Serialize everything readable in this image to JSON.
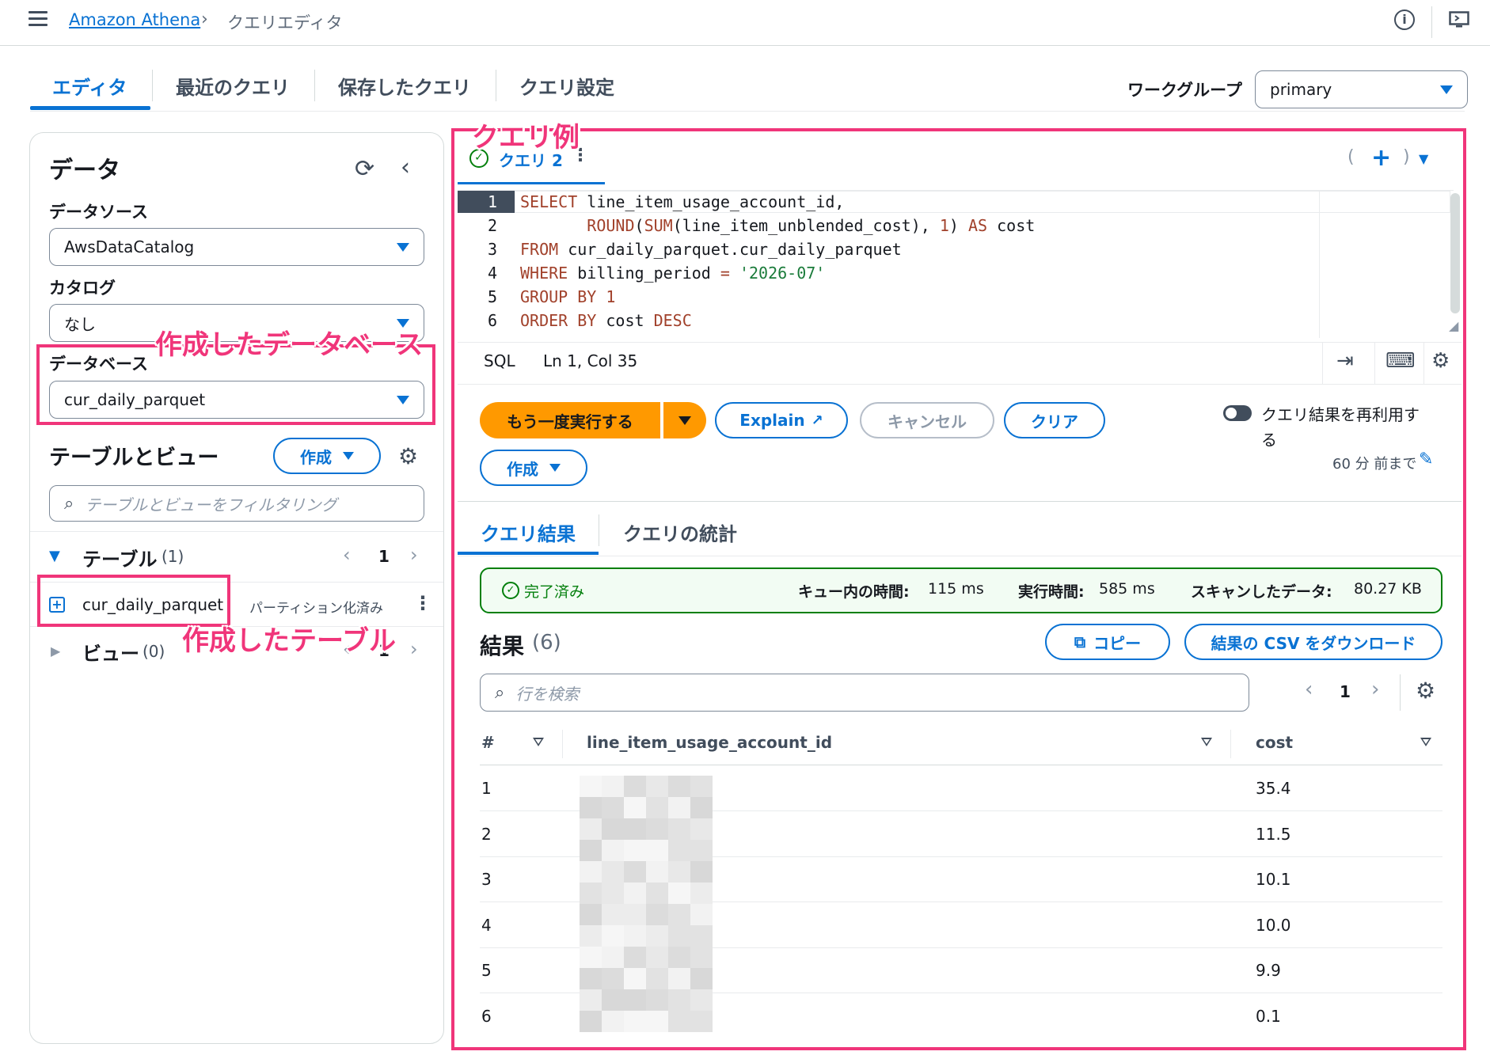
{
  "header": {
    "service_link": "Amazon Athena",
    "breadcrumb_sep": "›",
    "current_page": "クエリエディタ",
    "info_icon": "info-icon",
    "screen_icon": "screen-icon"
  },
  "tabs": [
    {
      "label": "エディタ",
      "active": true
    },
    {
      "label": "最近のクエリ",
      "active": false
    },
    {
      "label": "保存したクエリ",
      "active": false
    },
    {
      "label": "クエリ設定",
      "active": false
    }
  ],
  "workgroup": {
    "label": "ワークグループ",
    "value": "primary"
  },
  "data_panel": {
    "title": "データ",
    "datasource_label": "データソース",
    "datasource_value": "AwsDataCatalog",
    "catalog_label": "カタログ",
    "catalog_value": "なし",
    "database_label": "データベース",
    "database_value": "cur_daily_parquet",
    "tables_views_title": "テーブルとビュー",
    "create_button": "作成",
    "filter_placeholder": "テーブルとビューをフィルタリング",
    "tables_label": "テーブル",
    "tables_count": "(1)",
    "tables_page": "1",
    "table_item": {
      "name": "cur_daily_parquet",
      "badge": "パーティション化済み"
    },
    "views_label": "ビュー",
    "views_count": "(0)",
    "views_page": "1"
  },
  "annotations": {
    "query_example": "クエリ例",
    "created_database": "作成したデータベース",
    "created_table": "作成したテーブル"
  },
  "editor": {
    "query_tab": "クエリ 2",
    "code_lines": [
      {
        "no": "1"
      },
      {
        "no": "2"
      },
      {
        "no": "3"
      },
      {
        "no": "4"
      },
      {
        "no": "5"
      },
      {
        "no": "6"
      }
    ],
    "code": {
      "l1_kw": "SELECT",
      "l1_rest": " line_item_usage_account_id,",
      "l2_indent": "       ",
      "l2_kw1": "ROUND",
      "l2_p1": "(",
      "l2_kw2": "SUM",
      "l2_rest": "(line_item_unblended_cost), ",
      "l2_num": "1",
      "l2_p2": ") ",
      "l2_kw3": "AS",
      "l2_end": " cost",
      "l3_kw": "FROM",
      "l3_rest": " cur_daily_parquet.cur_daily_parquet",
      "l4_kw": "WHERE",
      "l4_rest": " billing_period ",
      "l4_op": "=",
      "l4_sp": " ",
      "l4_str": "'2026-07'",
      "l5_kw": "GROUP BY",
      "l5_sp": " ",
      "l5_num": "1",
      "l6_kw": "ORDER BY",
      "l6_rest": " cost ",
      "l6_kw2": "DESC"
    },
    "status_lang": "SQL",
    "status_pos": "Ln 1, Col 35"
  },
  "actions": {
    "run_again": "もう一度実行する",
    "explain": "Explain",
    "cancel": "キャンセル",
    "clear": "クリア",
    "create": "作成",
    "reuse_label_1": "クエリ結果を再利用す",
    "reuse_label_2": "る",
    "reuse_time": "60 分 前まで"
  },
  "result_tabs": [
    {
      "label": "クエリ結果",
      "active": true
    },
    {
      "label": "クエリの統計",
      "active": false
    }
  ],
  "status": {
    "state": "完了済み",
    "queue_label": "キュー内の時間:",
    "queue_value": "115 ms",
    "exec_label": "実行時間:",
    "exec_value": "585 ms",
    "scan_label": "スキャンしたデータ:",
    "scan_value": "80.27 KB"
  },
  "results": {
    "title": "結果",
    "count": "(6)",
    "copy_button": "コピー",
    "download_button": "結果の CSV をダウンロード",
    "search_placeholder": "行を検索",
    "page": "1",
    "columns": [
      "#",
      "line_item_usage_account_id",
      "cost"
    ],
    "rows": [
      {
        "n": "1",
        "cost": "35.4"
      },
      {
        "n": "2",
        "cost": "11.5"
      },
      {
        "n": "3",
        "cost": "10.1"
      },
      {
        "n": "4",
        "cost": "10.0"
      },
      {
        "n": "5",
        "cost": "9.9"
      },
      {
        "n": "6",
        "cost": "0.1"
      }
    ]
  }
}
